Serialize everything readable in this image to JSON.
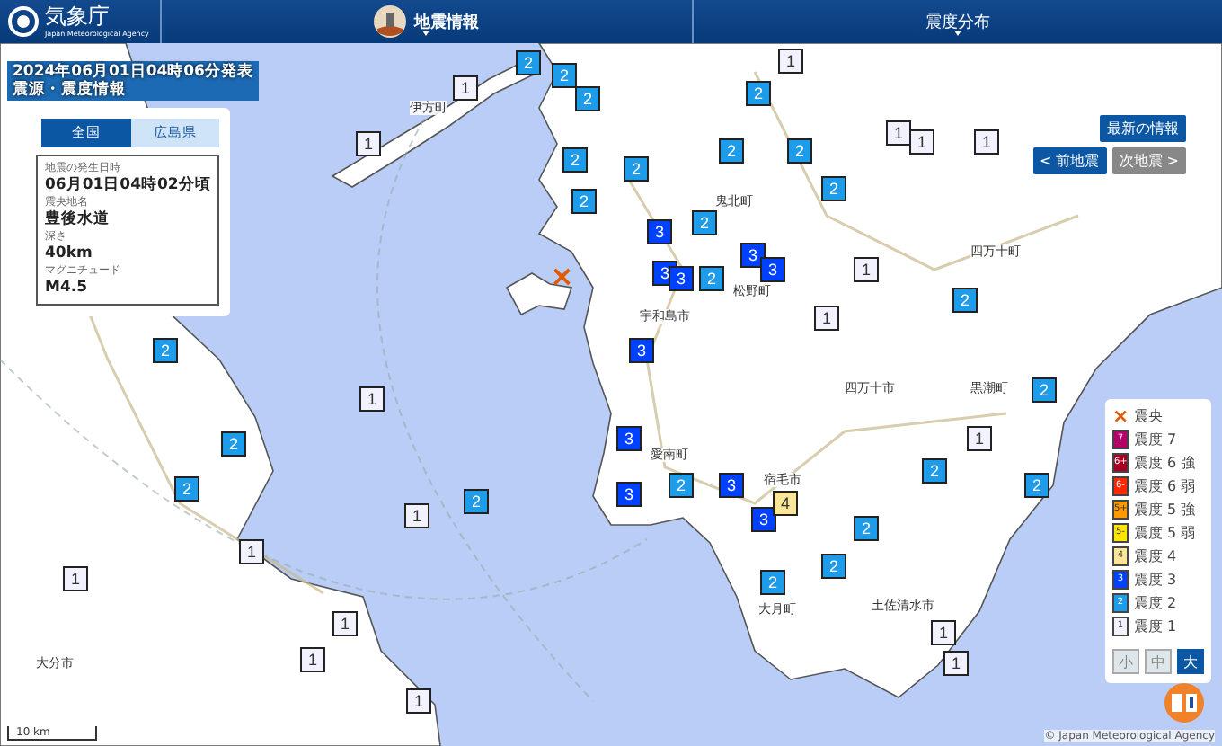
{
  "header": {
    "logo_text": "気象庁",
    "logo_subtext": "Japan Meteorological Agency",
    "menu": [
      {
        "label": "地震情報",
        "selected": true
      },
      {
        "label": "震度分布",
        "selected": false
      }
    ]
  },
  "title": {
    "issued": "2024年06月01日04時06分発表",
    "subtitle": "震源・震度情報"
  },
  "region_tabs": [
    {
      "label": "全国",
      "selected": true
    },
    {
      "label": "広島県",
      "selected": false
    }
  ],
  "quake_info": [
    {
      "label": "地震の発生日時",
      "value": "06月01日04時02分頃"
    },
    {
      "label": "震央地名",
      "value": "豊後水道"
    },
    {
      "label": "深さ",
      "value": "40km"
    },
    {
      "label": "マグニチュード",
      "value": "M4.5"
    }
  ],
  "nav_buttons": [
    {
      "label": "最新の情報",
      "disabled": false
    },
    {
      "label": "< 前地震",
      "disabled": false
    },
    {
      "label": "次地震 >",
      "disabled": true
    }
  ],
  "epicenter": {
    "symbol": "×"
  },
  "place_labels": [
    "伊方町",
    "鬼北町",
    "宇和島市",
    "松野町",
    "四万十町",
    "四万十市",
    "黒潮町",
    "愛南町",
    "宿毛市",
    "大月町",
    "土佐清水市",
    "大分市"
  ],
  "markers": [
    {
      "intensity": "2",
      "color": "#1e9be9"
    },
    {
      "intensity": "2",
      "color": "#1e9be9"
    },
    {
      "intensity": "2",
      "color": "#1e9be9"
    },
    {
      "intensity": "1",
      "color": "#f2f2ff"
    },
    {
      "intensity": "1",
      "color": "#f2f2ff"
    },
    {
      "intensity": "2",
      "color": "#1e9be9"
    },
    {
      "intensity": "2",
      "color": "#1e9be9"
    },
    {
      "intensity": "2",
      "color": "#1e9be9"
    },
    {
      "intensity": "3",
      "color": "#0041ff"
    },
    {
      "intensity": "2",
      "color": "#1e9be9"
    },
    {
      "intensity": "3",
      "color": "#0041ff"
    },
    {
      "intensity": "3",
      "color": "#0041ff"
    },
    {
      "intensity": "2",
      "color": "#1e9be9"
    },
    {
      "intensity": "3",
      "color": "#0041ff"
    },
    {
      "intensity": "3",
      "color": "#0041ff"
    },
    {
      "intensity": "2",
      "color": "#1e9be9"
    },
    {
      "intensity": "2",
      "color": "#1e9be9"
    },
    {
      "intensity": "2",
      "color": "#1e9be9"
    },
    {
      "intensity": "2",
      "color": "#1e9be9"
    },
    {
      "intensity": "1",
      "color": "#f2f2ff"
    },
    {
      "intensity": "1",
      "color": "#f2f2ff"
    },
    {
      "intensity": "1",
      "color": "#f2f2ff"
    },
    {
      "intensity": "1",
      "color": "#f2f2ff"
    },
    {
      "intensity": "1",
      "color": "#f2f2ff"
    },
    {
      "intensity": "1",
      "color": "#f2f2ff"
    },
    {
      "intensity": "3",
      "color": "#0041ff"
    },
    {
      "intensity": "3",
      "color": "#0041ff"
    },
    {
      "intensity": "3",
      "color": "#0041ff"
    },
    {
      "intensity": "2",
      "color": "#1e9be9"
    },
    {
      "intensity": "3",
      "color": "#0041ff"
    },
    {
      "intensity": "3",
      "color": "#0041ff"
    },
    {
      "intensity": "4",
      "color": "#fae696"
    },
    {
      "intensity": "2",
      "color": "#1e9be9"
    },
    {
      "intensity": "2",
      "color": "#1e9be9"
    },
    {
      "intensity": "2",
      "color": "#1e9be9"
    },
    {
      "intensity": "2",
      "color": "#1e9be9"
    },
    {
      "intensity": "1",
      "color": "#f2f2ff"
    },
    {
      "intensity": "1",
      "color": "#f2f2ff"
    },
    {
      "intensity": "2",
      "color": "#1e9be9"
    },
    {
      "intensity": "2",
      "color": "#1e9be9"
    },
    {
      "intensity": "2",
      "color": "#1e9be9"
    },
    {
      "intensity": "1",
      "color": "#f2f2ff"
    },
    {
      "intensity": "2",
      "color": "#1e9be9"
    },
    {
      "intensity": "2",
      "color": "#1e9be9"
    },
    {
      "intensity": "2",
      "color": "#1e9be9"
    },
    {
      "intensity": "1",
      "color": "#f2f2ff"
    },
    {
      "intensity": "1",
      "color": "#f2f2ff"
    },
    {
      "intensity": "1",
      "color": "#f2f2ff"
    },
    {
      "intensity": "1",
      "color": "#f2f2ff"
    },
    {
      "intensity": "1",
      "color": "#f2f2ff"
    },
    {
      "intensity": "1",
      "color": "#f2f2ff"
    },
    {
      "intensity": "2",
      "color": "#1e9be9"
    },
    {
      "intensity": "1",
      "color": "#f2f2ff"
    }
  ],
  "legend": [
    {
      "kind": "epicenter",
      "badge": "×",
      "label": "震央",
      "color": "#e05a00"
    },
    {
      "kind": "intensity",
      "badge": "7",
      "label": "震度 7",
      "color": "#b40068"
    },
    {
      "kind": "intensity",
      "badge": "6+",
      "label": "震度 6 強",
      "color": "#a50021"
    },
    {
      "kind": "intensity",
      "badge": "6-",
      "label": "震度 6 弱",
      "color": "#ff2800"
    },
    {
      "kind": "intensity",
      "badge": "5+",
      "label": "震度 5 強",
      "color": "#ff9900"
    },
    {
      "kind": "intensity",
      "badge": "5-",
      "label": "震度 5 弱",
      "color": "#ffe600"
    },
    {
      "kind": "intensity",
      "badge": "4",
      "label": "震度 4",
      "color": "#fae696"
    },
    {
      "kind": "intensity",
      "badge": "3",
      "label": "震度 3",
      "color": "#0041ff"
    },
    {
      "kind": "intensity",
      "badge": "2",
      "label": "震度 2",
      "color": "#1e9be9"
    },
    {
      "kind": "intensity",
      "badge": "1",
      "label": "震度 1",
      "color": "#f2f2ff"
    }
  ],
  "size_buttons": [
    {
      "label": "小",
      "selected": false
    },
    {
      "label": "中",
      "selected": false
    },
    {
      "label": "大",
      "selected": true
    }
  ],
  "scale": "10 km",
  "copyright": "© Japan Meteorological Agency"
}
